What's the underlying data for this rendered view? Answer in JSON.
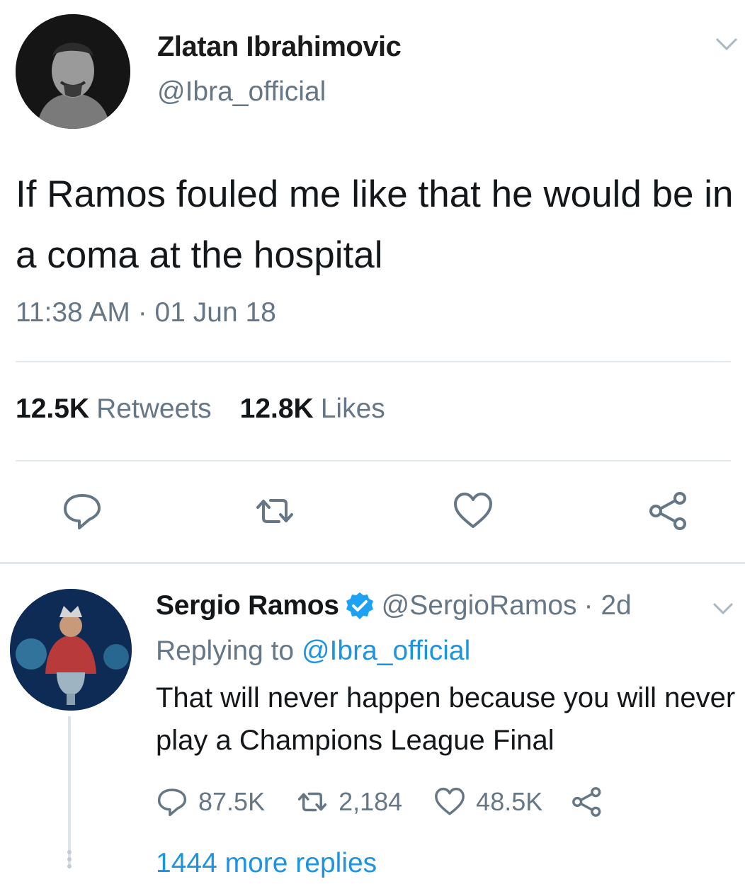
{
  "tweet": {
    "author_name": "Zlatan Ibrahimovic",
    "author_handle": "@Ibra_official",
    "text": "If Ramos fouled me like that he would be in a coma at the hospital",
    "timestamp": "11:38 AM · 01 Jun 18",
    "retweets_count": "12.5K",
    "retweets_label": "Retweets",
    "likes_count": "12.8K",
    "likes_label": "Likes",
    "icons": [
      "reply-icon",
      "retweet-icon",
      "like-icon",
      "share-icon"
    ]
  },
  "reply": {
    "author_name": "Sergio Ramos",
    "verified": true,
    "author_handle": "@SergioRamos",
    "age": "· 2d",
    "replying_prefix": "Replying to",
    "replying_to": "@Ibra_official",
    "text": "That will never happen because you will never play a Champions League Final",
    "reply_count": "87.5K",
    "retweet_count": "2,184",
    "like_count": "48.5K",
    "more_replies": "1444 more replies"
  },
  "colors": {
    "text": "#14171a",
    "secondary": "#657786",
    "link": "#1b95e0",
    "divider": "#e1e8ed"
  }
}
